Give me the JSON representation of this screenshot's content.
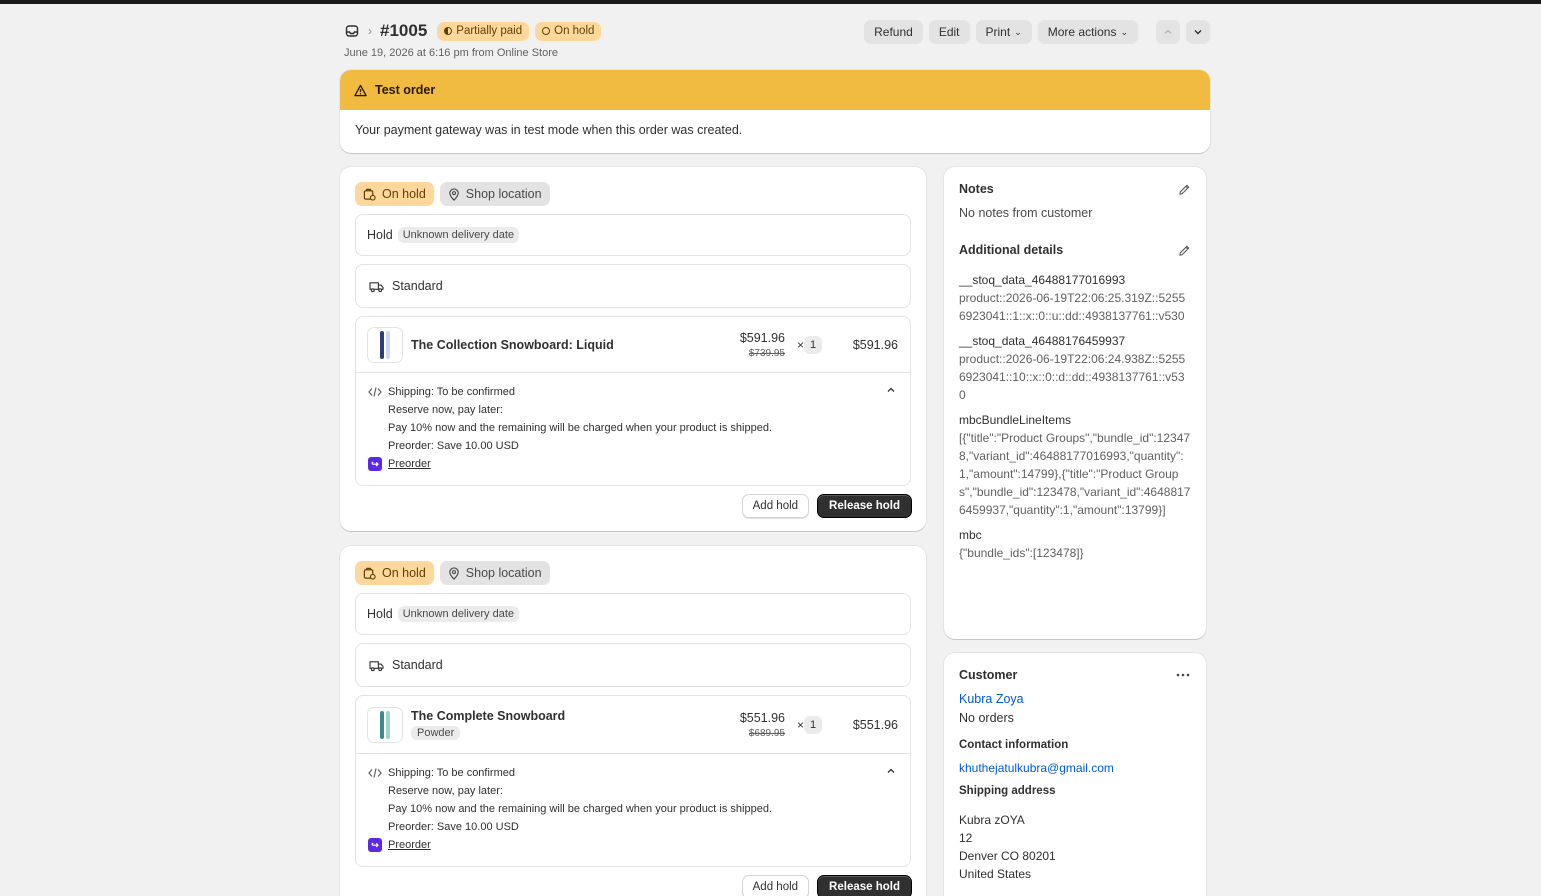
{
  "header": {
    "order_number": "#1005",
    "badge_payment": "Partially paid",
    "badge_status": "On hold",
    "subtitle": "June 19, 2026 at 6:16 pm from Online Store",
    "actions": {
      "refund": "Refund",
      "edit": "Edit",
      "print": "Print",
      "more": "More actions"
    }
  },
  "banner": {
    "title": "Test order",
    "body": "Your payment gateway was in test mode when this order was created."
  },
  "fulfillments": [
    {
      "status": "On hold",
      "location": "Shop location",
      "hold_label": "Hold",
      "hold_tag": "Unknown delivery date",
      "shipping_method": "Standard",
      "item": {
        "title": "The Collection Snowboard: Liquid",
        "variant": "",
        "price": "$591.96",
        "original_price": "$739.95",
        "times": "×",
        "quantity": "1",
        "total": "$591.96"
      },
      "props": {
        "shipping": "Shipping: To be confirmed",
        "line1": "Reserve now, pay later:",
        "line2": "Pay 10% now and the remaining will be charged when your product is shipped.",
        "line3": "Preorder: Save 10.00 USD",
        "link": "Preorder"
      },
      "add_hold": "Add hold",
      "release_hold": "Release hold"
    },
    {
      "status": "On hold",
      "location": "Shop location",
      "hold_label": "Hold",
      "hold_tag": "Unknown delivery date",
      "shipping_method": "Standard",
      "item": {
        "title": "The Complete Snowboard",
        "variant": "Powder",
        "price": "$551.96",
        "original_price": "$689.95",
        "times": "×",
        "quantity": "1",
        "total": "$551.96"
      },
      "props": {
        "shipping": "Shipping: To be confirmed",
        "line1": "Reserve now, pay later:",
        "line2": "Pay 10% now and the remaining will be charged when your product is shipped.",
        "line3": "Preorder: Save 10.00 USD",
        "link": "Preorder"
      },
      "add_hold": "Add hold",
      "release_hold": "Release hold"
    }
  ],
  "notes": {
    "title": "Notes",
    "text": "No notes from customer",
    "additional_title": "Additional details",
    "details": [
      {
        "key": "__stoq_data_46488177016993",
        "value": "product::2026-06-19T22:06:25.319Z::52556923041::1::x::0::u::dd::4938137761::v530"
      },
      {
        "key": "__stoq_data_46488176459937",
        "value": "product::2026-06-19T22:06:24.938Z::52556923041::10::x::0::d::dd::4938137761::v530"
      },
      {
        "key": "mbcBundleLineItems",
        "value": "[{\"title\":\"Product Groups\",\"bundle_id\":123478,\"variant_id\":46488177016993,\"quantity\":1,\"amount\":14799},{\"title\":\"Product Groups\",\"bundle_id\":123478,\"variant_id\":46488176459937,\"quantity\":1,\"amount\":13799}]"
      },
      {
        "key": "mbc",
        "value": "{\"bundle_ids\":[123478]}"
      }
    ]
  },
  "customer": {
    "title": "Customer",
    "name": "Kubra Zoya",
    "orders": "No orders",
    "contact_title": "Contact information",
    "email": "khuthejatulkubra@gmail.com",
    "shipping_title": "Shipping address",
    "address_name": "Kubra zOYA",
    "address_line1": "12",
    "address_city": "Denver CO 80201",
    "address_country": "United States"
  }
}
